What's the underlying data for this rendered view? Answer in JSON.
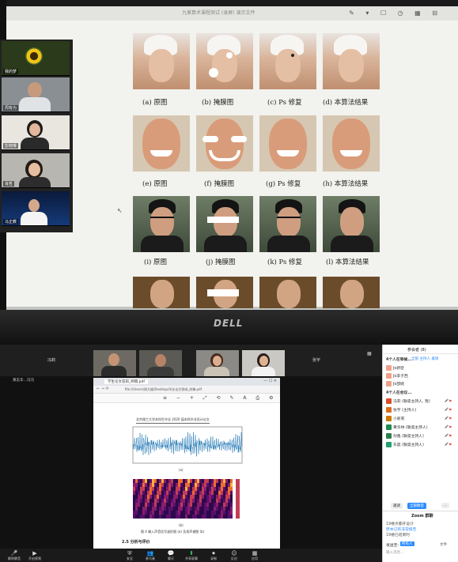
{
  "top_photo": {
    "window_title": "九章算术课程测试 (录屏) 演示文件",
    "video_names": [
      "我的梦",
      "周有为",
      "彭晓琳",
      "肖哲",
      "马正教"
    ],
    "captions": [
      "(a) 原图",
      "(b) 掩膜图",
      "(c) Ps 修复",
      "(d) 本算法结果",
      "(e) 原图",
      "(f) 掩膜图",
      "(g) Ps 修复",
      "(h) 本算法结果",
      "(i) 原图",
      "(j) 掩膜图",
      "(k) Ps 修复",
      "(l) 本算法结果"
    ],
    "monitor_brand": "DELL"
  },
  "zoom": {
    "top_names": [
      "冯莉",
      "张宇"
    ],
    "left_label": "黄志华...",
    "left_label2": "冯冯",
    "browser_tab": "学生论文答辩_终稿.pdf",
    "address": "file:///Users/周大维/Desktop/毕业论文答辩_终稿.pdf",
    "doc_header": "北京理工大学本科生毕业 2020 届本科毕业设计论文",
    "fig_label_a": "(a)",
    "fig_label_b": "(b)",
    "figure_caption": "图 4 输入声音信号波形图 (a) 及其声谱图 (b)",
    "section_heading": "2.5  分析与评价",
    "bottom_bar": [
      {
        "icon": "mic-icon",
        "label": "解除静音"
      },
      {
        "icon": "video-icon",
        "label": "开启视频"
      },
      {
        "icon": "security-icon",
        "label": "安全"
      },
      {
        "icon": "participants-icon",
        "label": "参与者"
      },
      {
        "icon": "chat-icon",
        "label": "聊天"
      },
      {
        "icon": "share-icon",
        "label": "共享屏幕"
      },
      {
        "icon": "record-icon",
        "label": "录制"
      },
      {
        "icon": "reactions-icon",
        "label": "反应"
      },
      {
        "icon": "apps-icon",
        "label": "应用"
      }
    ]
  },
  "sidebar": {
    "title": "参会者 (8)",
    "tabs": [
      "全部",
      "主持人",
      "邀请"
    ],
    "waiting_label": "4个人在等候...",
    "waiting": [
      "Jo新密",
      "Jo李子西",
      "Jo邵婉"
    ],
    "in_meeting_label": "4个人在会议...",
    "in_meeting": [
      {
        "name": "冯莉 (联席主持人, 我)",
        "color": "#d84f2a"
      },
      {
        "name": "张宇 (主持人)",
        "color": "#e06c1d"
      },
      {
        "name": "小新莉",
        "color": "#cc7a00"
      },
      {
        "name": "黄华林 (联席主持人)",
        "color": "#1f8a52"
      },
      {
        "name": "孙鑫 (联席主持人)",
        "color": "#2f7d4a"
      },
      {
        "name": "东晨 (联席主持人)",
        "color": "#23a06b"
      }
    ],
    "invite_button": "邀请",
    "mute_all_button": "全部静音",
    "more_button": "...",
    "chat_title": "Zoom 群聊",
    "chat_lines": [
      "19楼点都开设计",
      "原本已有非常报告",
      "19楼已结束时"
    ],
    "send_to_label": "发送至:",
    "send_to_value": "所有人",
    "file_label": "文件",
    "input_placeholder": "输入消息..."
  }
}
